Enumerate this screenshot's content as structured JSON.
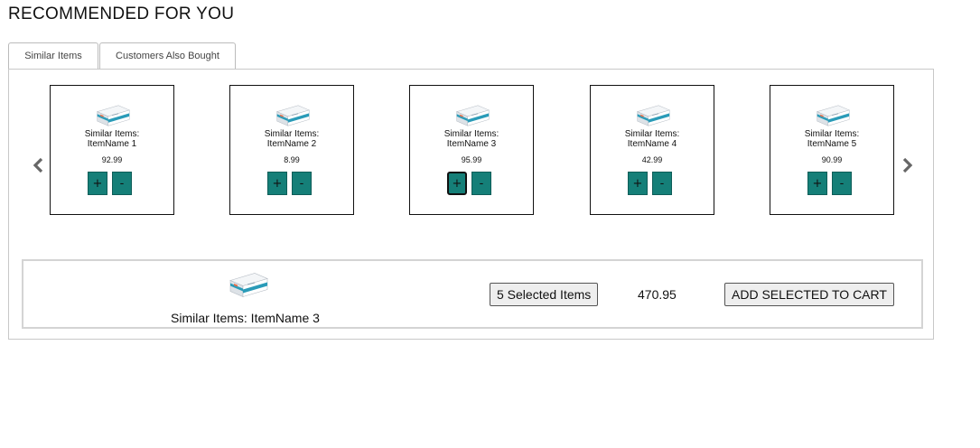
{
  "page": {
    "title": "RECOMMENDED FOR YOU"
  },
  "tabs": [
    {
      "label": "Similar Items"
    },
    {
      "label": "Customers Also Bought"
    }
  ],
  "carousel": {
    "prev_icon": "chevron-left-icon",
    "next_icon": "chevron-right-icon",
    "items": [
      {
        "name_line1": "Similar Items:",
        "name_line2": "ItemName 1",
        "price": "92.99",
        "add_label": "+",
        "remove_label": "-"
      },
      {
        "name_line1": "Similar Items:",
        "name_line2": "ItemName 2",
        "price": "8.99",
        "add_label": "+",
        "remove_label": "-"
      },
      {
        "name_line1": "Similar Items:",
        "name_line2": "ItemName 3",
        "price": "95.99",
        "add_label": "+",
        "remove_label": "-"
      },
      {
        "name_line1": "Similar Items:",
        "name_line2": "ItemName 4",
        "price": "42.99",
        "add_label": "+",
        "remove_label": "-"
      },
      {
        "name_line1": "Similar Items:",
        "name_line2": "ItemName 5",
        "price": "90.99",
        "add_label": "+",
        "remove_label": "-"
      }
    ]
  },
  "summary": {
    "selected_name": "Similar Items: ItemName 3",
    "selected_count_label": "5 Selected Items",
    "total": "470.95",
    "add_to_cart_label": "ADD SELECTED TO CART"
  },
  "colors": {
    "button_teal": "#157f78",
    "border": "#c8c8c8"
  }
}
